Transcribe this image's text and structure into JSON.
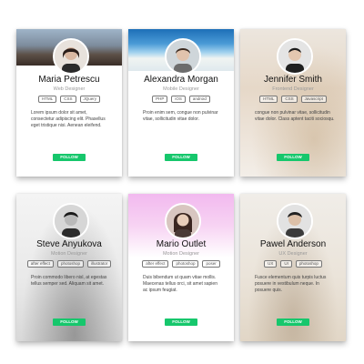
{
  "cards": [
    {
      "name": "Maria Petrescu",
      "role": "Web Designer",
      "tags": [
        "HTML",
        "CSS",
        "JQuery"
      ],
      "bio": "Lorem ipsum dolor sit amet, consectetur adipiscing elit. Phasellus eget tristique nisi. Aenean eleifend.",
      "follow": "FOLLOW"
    },
    {
      "name": "Alexandra Morgan",
      "role": "Mobile Designer",
      "tags": [
        "PHP",
        "iOS",
        "android"
      ],
      "bio": "Proin enim sem, congue non pulvinar vitae, sollicitudin vitae dolor.",
      "follow": "FOLLOW"
    },
    {
      "name": "Jennifer Smith",
      "role": "Frontend Designer",
      "tags": [
        "HTML",
        "CSS",
        "Javascript"
      ],
      "bio": "congue non pulvinar vitae, sollicitudin vitae dolor. Class aptent taciti sociosqu.",
      "follow": "FOLLOW"
    },
    {
      "name": "Steve Anyukova",
      "role": "Motion Designer",
      "tags": [
        "after effect",
        "photoshop",
        "illustrator"
      ],
      "bio": "Proin commodo libero nisl, at egestas tellus semper sed. Aliquam sit amet.",
      "follow": "FOLLOW"
    },
    {
      "name": "Mario Outlet",
      "role": "Motion Designer",
      "tags": [
        "after effect",
        "photoshop",
        "poser"
      ],
      "bio": "Duis bibendum ut quam vitae mollis. Maecenas tellus orci, sit amet sapien ac ipsum feugiat.",
      "follow": "FOLLOW"
    },
    {
      "name": "Pawel Anderson",
      "role": "UX Designer",
      "tags": [
        "UX",
        "UI",
        "photoshop"
      ],
      "bio": "Fusce elementum quis turpis luctus posuere in vestibulum neque. In posuere quis.",
      "follow": "FOLLOW"
    }
  ],
  "colors": {
    "follow_button": "#16c76c",
    "card_bg": "#ffffff",
    "tag_border": "#777777"
  },
  "icons": [
    "avatar-photo"
  ]
}
